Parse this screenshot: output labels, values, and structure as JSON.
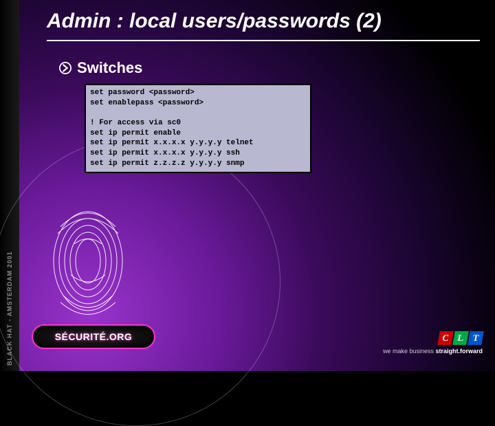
{
  "rail_text": "BLACK HAT - AMSTERDAM 2001",
  "title": "Admin : local users/passwords (2)",
  "bullet": "Switches",
  "code": {
    "l1": "set password <password>",
    "l2": "set enablepass <password>",
    "l3": "! For access via sc0",
    "l4": "set ip permit enable",
    "l5": "set ip permit x.x.x.x y.y.y.y telnet",
    "l6": "set ip permit x.x.x.x y.y.y.y ssh",
    "l7": "set ip permit z.z.z.z y.y.y.y snmp"
  },
  "logo": "SÉCURITÉ.ORG",
  "clt": {
    "c": "C",
    "l": "L",
    "t": "T"
  },
  "tagline_pre": "we make business ",
  "tagline_em": "straight.forward"
}
